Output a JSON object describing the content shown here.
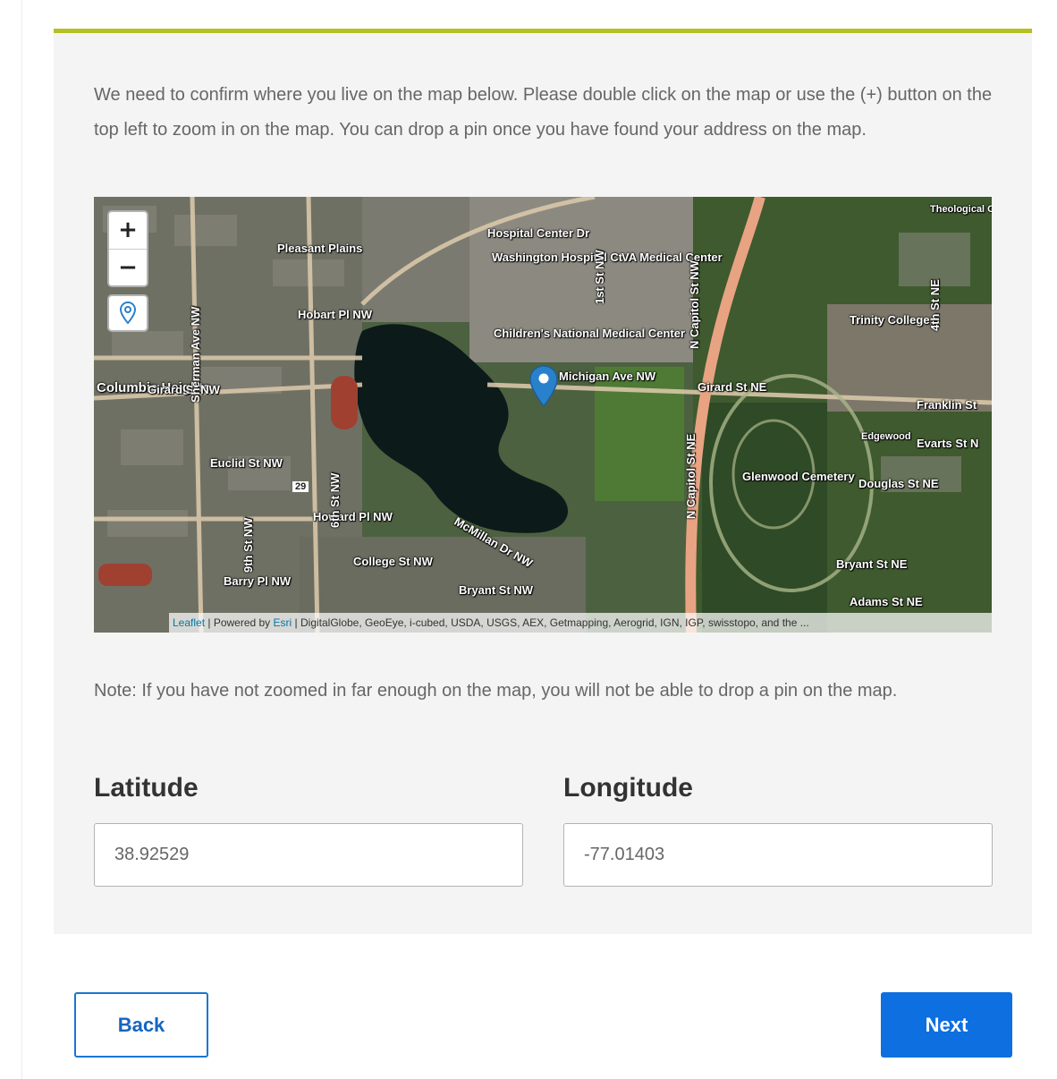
{
  "instructions": "We need to confirm where you live on the map below. Please double click on the map or use the (+) button on the top left to zoom in on the map. You can drop a pin once you have found your address on the map.",
  "map": {
    "zoom_in": "+",
    "zoom_out": "−",
    "attribution": {
      "leaflet": "Leaflet",
      "powered_by": " | Powered by ",
      "esri": "Esri",
      "sources": " | DigitalGlobe, GeoEye, i-cubed, USDA, USGS, AEX, Getmapping, Aerogrid, IGN, IGP, swisstopo, and the ..."
    },
    "labels": {
      "hospital_center_dr": "Hospital Center Dr",
      "washington_hospital": "Washington Hospital Ct",
      "va_medical": "VA Medical Center",
      "pleasant_plains": "Pleasant Plains",
      "hobart_pl": "Hobart Pl NW",
      "columbia_heights": "Columbia Heights",
      "girard_st_nw": "Girard St NW",
      "childrens": "Children's National Medical Center",
      "michigan_ave": "Michigan Ave NW",
      "girard_st_ne": "Girard St NE",
      "trinity_college": "Trinity College",
      "franklin_st": "Franklin St",
      "evarts_st": "Evarts St N",
      "edgewood": "Edgewood",
      "douglas_st": "Douglas St NE",
      "euclid_st": "Euclid St NW",
      "howard_pl": "Howard Pl NW",
      "mcmillan_dr": "McMillan Dr NW",
      "college_st": "College St NW",
      "barry_pl": "Barry Pl NW",
      "bryant_st_nw": "Bryant St NW",
      "bryant_st_ne": "Bryant St NE",
      "adams_st": "Adams St NE",
      "glenwood_cemetery": "Glenwood Cemetery",
      "n_capitol_st_ne": "N Capitol St NE",
      "n_capitol_st_nw": "N Capitol St NW",
      "first_st_nw": "1st St NW",
      "fourth_st_ne": "4th St NE",
      "sherman_ave": "Sherman Ave NW",
      "sixth_st_nw": "6th St NW",
      "ninth_st_nw": "9th St NW",
      "route_29": "29",
      "theological_college": "Theological College"
    }
  },
  "note": "Note: If you have not zoomed in far enough on the map, you will not be able to drop a pin on the map.",
  "latitude": {
    "label": "Latitude",
    "value": "38.92529"
  },
  "longitude": {
    "label": "Longitude",
    "value": "-77.01403"
  },
  "buttons": {
    "back": "Back",
    "next": "Next"
  },
  "colors": {
    "accent_bar": "#b4c023",
    "primary": "#0d6fe0",
    "marker": "#2a81cb"
  },
  "icons": {
    "zoom_in": "plus-icon",
    "zoom_out": "minus-icon",
    "drop_pin": "map-pin-icon",
    "marker": "map-marker-icon"
  }
}
